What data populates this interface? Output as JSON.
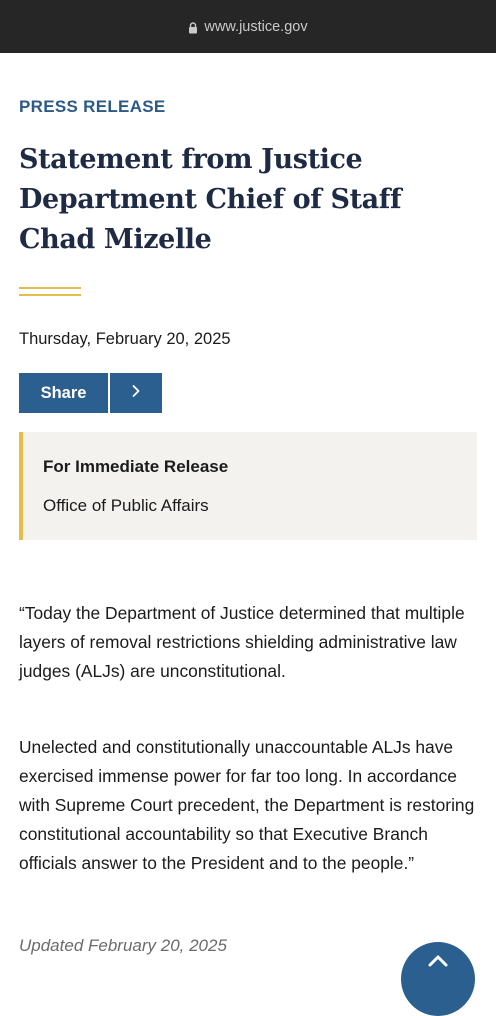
{
  "browser": {
    "url": "www.justice.gov",
    "icon": "lock-icon"
  },
  "article": {
    "eyebrow": "PRESS RELEASE",
    "title": "Statement from Justice Department Chief of Staff Chad Mizelle",
    "date": "Thursday, February 20, 2025",
    "share_label": "Share",
    "share_icon": "chevron-right-icon",
    "callout": {
      "heading": "For Immediate Release",
      "office": "Office of Public Affairs"
    },
    "paragraphs": [
      "“Today the Department of Justice determined that multiple layers of removal restrictions shielding administrative law judges (ALJs) are unconstitutional.",
      "Unelected and constitutionally unaccountable ALJs have exercised immense power for far too long. In accordance with Supreme Court precedent, the Department is restoring constitutional accountability so that Executive Branch officials answer to the President and to the people.”"
    ],
    "updated": "Updated February 20, 2025"
  },
  "colors": {
    "accent": "#2a5f8f",
    "gold": "#e6bc4b",
    "title": "#1f2b45",
    "bar": "#262626"
  }
}
